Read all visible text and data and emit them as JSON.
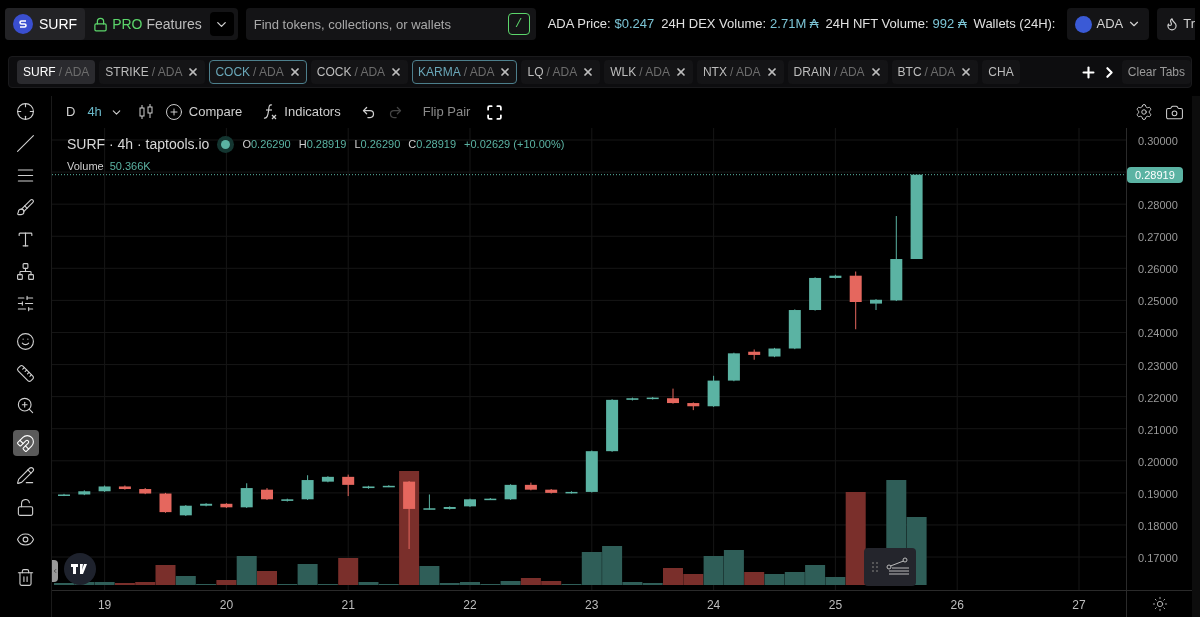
{
  "header": {
    "token_button": "SURF",
    "pro": {
      "badge": "PRO",
      "label": "Features"
    },
    "search": {
      "placeholder": "Find tokens, collections, or wallets",
      "shortcut": "/"
    },
    "stats": [
      {
        "label": "ADA Price:",
        "value": "$0.247"
      },
      {
        "label": "24H DEX Volume:",
        "value": "2.71M ₳"
      },
      {
        "label": "24H NFT Volume:",
        "value": "992 ₳"
      },
      {
        "label": "Wallets (24H):"
      }
    ],
    "currency": "ADA",
    "trending_button": "Tr"
  },
  "tabs": [
    {
      "base": "SURF",
      "quote": "/ ADA",
      "selected": true,
      "outlined": false,
      "closable": false
    },
    {
      "base": "STRIKE",
      "quote": "/ ADA",
      "selected": false,
      "outlined": false,
      "closable": true
    },
    {
      "base": "COCK",
      "quote": "/ ADA",
      "selected": false,
      "outlined": true,
      "closable": true
    },
    {
      "base": "COCK",
      "quote": "/ ADA",
      "selected": false,
      "outlined": false,
      "closable": true
    },
    {
      "base": "KARMA",
      "quote": "/ ADA",
      "selected": false,
      "outlined": true,
      "closable": true
    },
    {
      "base": "LQ",
      "quote": "/ ADA",
      "selected": false,
      "outlined": false,
      "closable": true
    },
    {
      "base": "WLK",
      "quote": "/ ADA",
      "selected": false,
      "outlined": false,
      "closable": true
    },
    {
      "base": "NTX",
      "quote": "/ ADA",
      "selected": false,
      "outlined": false,
      "closable": true
    },
    {
      "base": "DRAIN",
      "quote": "/ ADA",
      "selected": false,
      "outlined": false,
      "closable": true
    },
    {
      "base": "BTC",
      "quote": "/ ADA",
      "selected": false,
      "outlined": false,
      "closable": true
    },
    {
      "base": "CHA",
      "selected": false,
      "outlined": false,
      "closable": false
    }
  ],
  "clear_tabs": "Clear Tabs",
  "chart_toolbar": {
    "intervals": [
      {
        "label": "D",
        "selected": false
      },
      {
        "label": "4h",
        "selected": true
      }
    ],
    "compare": "Compare",
    "indicators": "Indicators",
    "redo_disabled": true,
    "flip_pair": "Flip Pair"
  },
  "tools": [
    {
      "kind": "crosshair",
      "selected": false
    },
    {
      "kind": "trendline",
      "selected": false
    },
    {
      "kind": "lines",
      "selected": false
    },
    {
      "kind": "brush",
      "selected": false
    },
    {
      "kind": "text",
      "selected": false
    },
    {
      "kind": "pattern",
      "selected": false
    },
    {
      "kind": "fib",
      "selected": false
    },
    {
      "kind": "emoji",
      "selected": false
    },
    {
      "kind": "ruler",
      "selected": false
    },
    {
      "kind": "zoom",
      "selected": false
    },
    {
      "kind": "magnet",
      "selected": true
    },
    {
      "kind": "draw-lock",
      "selected": false
    },
    {
      "kind": "lock",
      "selected": false
    },
    {
      "kind": "eye",
      "selected": false
    },
    {
      "kind": "trash",
      "selected": false
    }
  ],
  "legend": {
    "title": "SURF · 4h · taptools.io",
    "ohlc": [
      {
        "label": "O",
        "value": "0.26290"
      },
      {
        "label": "H",
        "value": "0.28919"
      },
      {
        "label": "L",
        "value": "0.26290"
      },
      {
        "label": "C",
        "value": "0.28919"
      }
    ],
    "change": "+0.02629 (+10.00%)",
    "volume_label": "Volume",
    "volume_value": "50.366K"
  },
  "last_price": "0.28919",
  "price_axis": [
    "0.30000",
    "0.28000",
    "0.27000",
    "0.26000",
    "0.25000",
    "0.24000",
    "0.23000",
    "0.22000",
    "0.21000",
    "0.20000",
    "0.19000",
    "0.18000",
    "0.17000"
  ],
  "time_axis": [
    "19",
    "20",
    "21",
    "22",
    "23",
    "24",
    "25",
    "26",
    "27"
  ]
}
